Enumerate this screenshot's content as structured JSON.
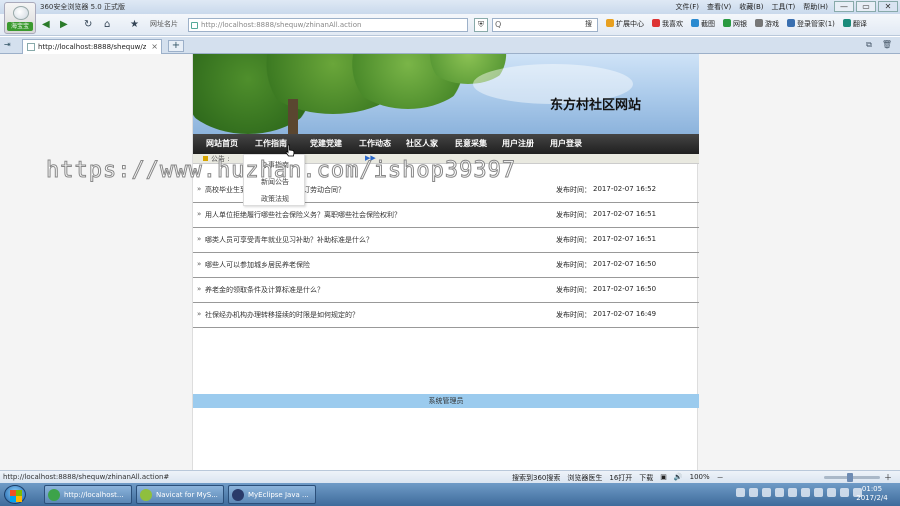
{
  "browser": {
    "title": "360安全浏览器 5.0 正式版",
    "logo_badge": "海宝宝",
    "menus": [
      "文件(F)",
      "查看(V)",
      "收藏(B)",
      "工具(T)",
      "帮助(H)"
    ],
    "window_controls": [
      "—",
      "▭",
      "✕"
    ]
  },
  "toolbar": {
    "back": "◀",
    "forward": "▶",
    "refresh": "↻",
    "home": "⌂",
    "favorite": "★",
    "address_label": "网址名片",
    "address_value": "http://localhost:8888/shequw/zhinanAll.action",
    "shield": "⛨",
    "search_placeholder": "Q",
    "search_button": "搜",
    "tools": [
      {
        "label": "扩展中心",
        "color": "#e8a020"
      },
      {
        "label": "我喜欢",
        "color": "#d33"
      },
      {
        "label": "截图",
        "color": "#2a8ad0"
      },
      {
        "label": "网银",
        "color": "#2a9a40"
      },
      {
        "label": "游戏",
        "color": "#777"
      },
      {
        "label": "登录管家(1)",
        "color": "#3a6fb0"
      },
      {
        "label": "翻译",
        "color": "#1a8a7a"
      }
    ]
  },
  "tabs": {
    "active_title": "http://localhost:8888/shequw/zhin...",
    "close": "×",
    "new": "+",
    "left_arrow": "⇥",
    "right_icons": [
      "⧉",
      "🗑"
    ]
  },
  "site": {
    "title": "东方村社区网站",
    "nav": [
      "网站首页",
      "工作指南",
      "党建党建",
      "工作动态",
      "社区人家",
      "民意采集",
      "用户注册",
      "用户登录"
    ],
    "dropdown": [
      "办事指南",
      "新闻公告",
      "政策法规"
    ],
    "announce_text": "公告 :",
    "announce_arrow": "▶▶",
    "articles": [
      {
        "title": "高校毕业生到基层就业是否要签订劳动合同？",
        "date": "2017-02-07 16:52"
      },
      {
        "title": "用人单位拒绝履行哪些社会保险义务？离职哪些社会保险权利？",
        "date": "2017-02-07 16:51"
      },
      {
        "title": "哪类人员可享受青年就业见习补助？补助标准是什么？",
        "date": "2017-02-07 16:51"
      },
      {
        "title": "哪些人可以参加城乡居民养老保险",
        "date": "2017-02-07 16:50"
      },
      {
        "title": "养老金的领取条件及计算标准是什么？",
        "date": "2017-02-07 16:50"
      },
      {
        "title": "社保经办机构办理转移接续的时限是如何规定的？",
        "date": "2017-02-07 16:49"
      }
    ],
    "date_label": "发布时间：",
    "footer": "系统管理员"
  },
  "watermark": "https://www.huzhan.com/ishop39397",
  "statusbar": {
    "url": "http://localhost:8888/shequw/zhinanAll.action#",
    "items": [
      "搜索到360搜索",
      "浏览器医生",
      "16打开",
      "下载",
      "▣",
      "🔊",
      "100%",
      "－",
      "＋"
    ],
    "zoom_fraction": 0.45
  },
  "taskbar": {
    "items": [
      {
        "label": "http://localhost...",
        "color": "#3da34a"
      },
      {
        "label": "Navicat for MyS...",
        "color": "#8fbf3e"
      },
      {
        "label": "MyEclipse Java ...",
        "color": "#2a3a6a"
      }
    ],
    "time": "01:05",
    "date": "2017/2/4"
  }
}
